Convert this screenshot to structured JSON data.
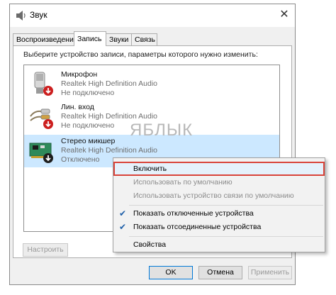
{
  "window": {
    "title": "Звук",
    "close_glyph": "✕"
  },
  "tabs": [
    {
      "label": "Воспроизведение",
      "active": false
    },
    {
      "label": "Запись",
      "active": true
    },
    {
      "label": "Звуки",
      "active": false
    },
    {
      "label": "Связь",
      "active": false
    }
  ],
  "instruction": "Выберите устройство записи, параметры которого нужно изменить:",
  "devices": [
    {
      "name": "Микрофон",
      "driver": "Realtek High Definition Audio",
      "status": "Не подключено",
      "icon": "microphone-icon"
    },
    {
      "name": "Лин. вход",
      "driver": "Realtek High Definition Audio",
      "status": "Не подключено",
      "icon": "line-in-icon"
    },
    {
      "name": "Стерео микшер",
      "driver": "Realtek High Definition Audio",
      "status": "Отключено",
      "icon": "sound-card-icon",
      "selected": true
    }
  ],
  "watermark": "ЯБЛЫК",
  "buttons": {
    "configure": "Настроить",
    "ok": "OK",
    "cancel": "Отмена",
    "apply": "Применить"
  },
  "context_menu": {
    "enable": "Включить",
    "set_default": "Использовать по умолчанию",
    "set_default_comm": "Использовать устройство связи по умолчанию",
    "show_disabled": "Показать отключенные устройства",
    "show_disconnected": "Показать отсоединенные устройства",
    "properties": "Свойства"
  },
  "colors": {
    "selection": "#cce8ff",
    "highlight_border": "#d9443a",
    "check": "#1e5fa8",
    "status_arrow": "#cc1f1f"
  }
}
